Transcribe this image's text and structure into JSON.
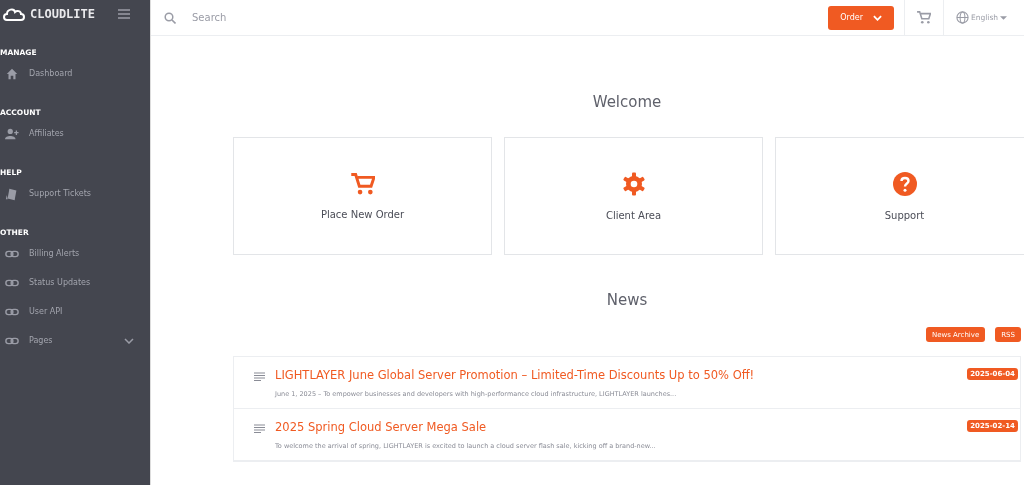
{
  "sidebar": {
    "logo": "CLOUDLITE",
    "sections": [
      {
        "label": "MANAGE",
        "items": [
          {
            "label": "Dashboard",
            "kind": "link"
          }
        ]
      },
      {
        "label": "ACCOUNT",
        "items": [
          {
            "label": "Affiliates",
            "kind": "link"
          }
        ]
      },
      {
        "label": "HELP",
        "items": [
          {
            "label": "Support Tickets",
            "kind": "link"
          }
        ]
      },
      {
        "label": "OTHER",
        "items": [
          {
            "label": "Billing Alerts",
            "kind": "link"
          },
          {
            "label": "Status Updates",
            "kind": "link"
          },
          {
            "label": "User API",
            "kind": "link"
          },
          {
            "label": "Pages",
            "kind": "submenu"
          }
        ]
      }
    ]
  },
  "topbar": {
    "search": {
      "placeholder": "Search"
    },
    "order_button": "Order",
    "language": "English"
  },
  "welcome": {
    "title": "Welcome",
    "cards": [
      {
        "label": "Place New Order"
      },
      {
        "label": "Client Area"
      },
      {
        "label": "Support"
      }
    ]
  },
  "news": {
    "title": "News",
    "buttons": [
      "News Archive",
      "RSS"
    ],
    "items": [
      {
        "title": "LIGHTLAYER June Global Server Promotion – Limited-Time Discounts Up to 50% Off!",
        "date": "2025-06-04",
        "excerpt": "June 1, 2025 – To empower businesses and developers with high-performance cloud infrastructure, LIGHTLAYER launches..."
      },
      {
        "title": "2025 Spring Cloud Server Mega Sale",
        "date": "2025-02-14",
        "excerpt": "To welcome the arrival of spring, LIGHTLAYER is excited to launch a cloud server flash sale, kicking off a brand-new..."
      }
    ]
  }
}
